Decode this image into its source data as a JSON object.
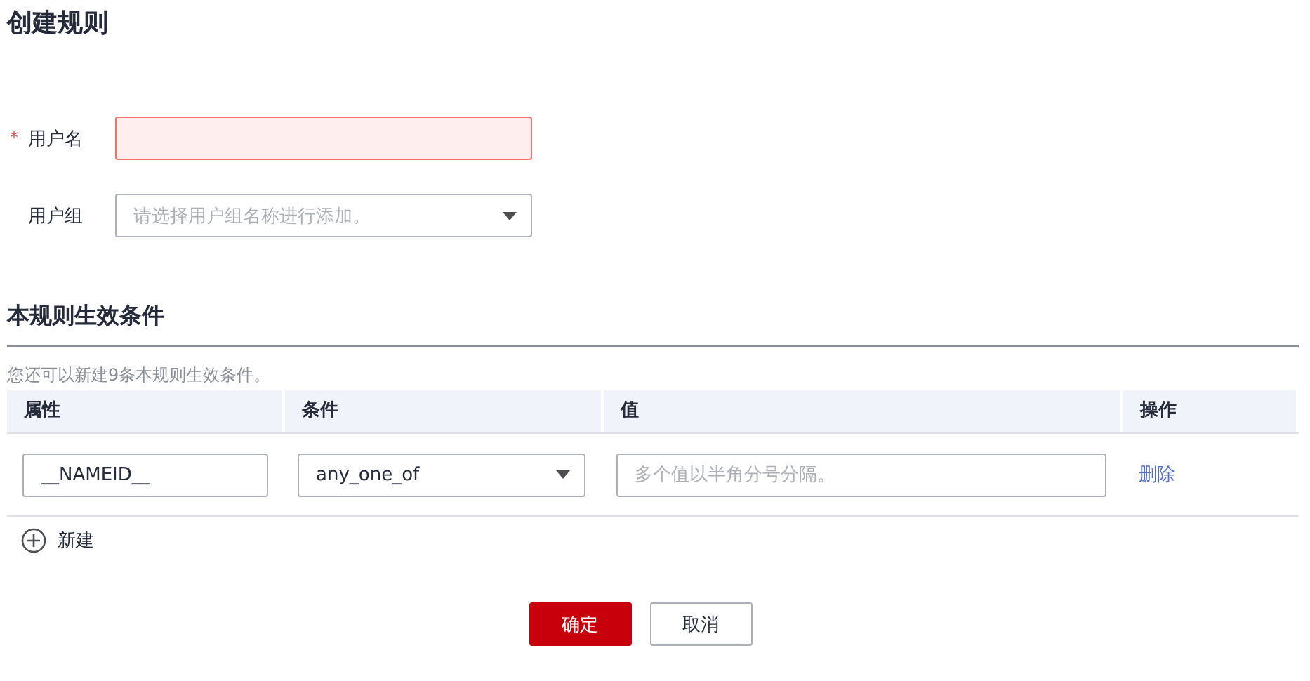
{
  "title": "创建规则",
  "form": [
    {
      "kind": "input",
      "required_mark": "*",
      "label": "用户名",
      "error": true
    },
    {
      "kind": "select",
      "label": "用户组",
      "error": false,
      "placeholder": "请选择用户组名称进行添加。"
    }
  ],
  "section_title": "本规则生效条件",
  "hint": "您还可以新建9条本规则生效条件。",
  "table": {
    "columns": [
      "属性",
      "条件",
      "值",
      "操作"
    ],
    "rows": [
      {
        "attribute": "__NAMEID__",
        "condition": "any_one_of",
        "value_placeholder": "多个值以半角分号分隔。",
        "action": "删除"
      }
    ]
  },
  "add_label": "新建",
  "buttons": [
    {
      "kind": "primary",
      "label": "确定"
    },
    {
      "kind": "secondary",
      "label": "取消"
    }
  ]
}
